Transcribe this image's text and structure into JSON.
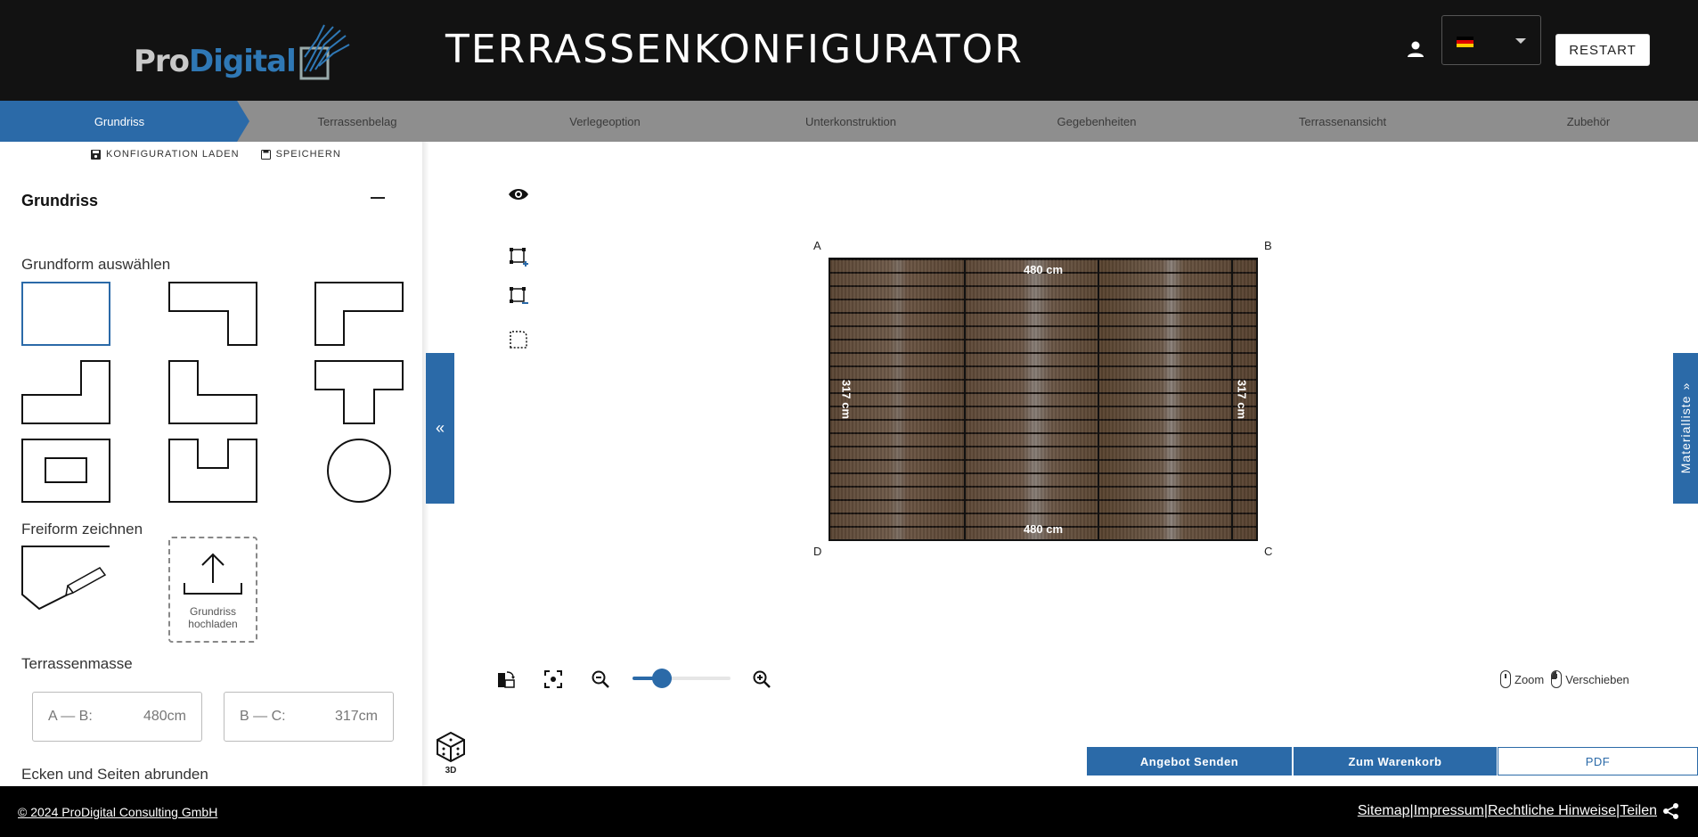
{
  "header": {
    "logo_pro": "Pro",
    "logo_digital": "Digital",
    "title": "TERRASSENKONFIGURATOR",
    "restart_label": "RESTART",
    "language_flag": "de"
  },
  "steps": [
    {
      "label": "Grundriss",
      "active": true
    },
    {
      "label": "Terrassenbelag"
    },
    {
      "label": "Verlegeoption"
    },
    {
      "label": "Unterkonstruktion"
    },
    {
      "label": "Gegebenheiten"
    },
    {
      "label": "Terrassenansicht"
    },
    {
      "label": "Zubehör"
    }
  ],
  "left_panel": {
    "load_label": "KONFIGURATION LADEN",
    "save_label": "SPEICHERN",
    "section_title": "Grundriss",
    "shape_label": "Grundform auswählen",
    "freeform_label": "Freiform zeichnen",
    "upload_label_1": "Grundriss",
    "upload_label_2": "hochladen",
    "dimensions_label": "Terrassenmasse",
    "dim_ab_label": "A — B:",
    "dim_ab_value": "480cm",
    "dim_bc_label": "B — C:",
    "dim_bc_value": "317cm",
    "round_label": "Ecken und Seiten abrunden"
  },
  "canvas": {
    "corners": [
      "A",
      "B",
      "C",
      "D"
    ],
    "top_dim": "480 cm",
    "bottom_dim": "480 cm",
    "left_dim": "317 cm",
    "right_dim": "317 cm",
    "zoom_level": 0.3,
    "hint_zoom": "Zoom",
    "hint_move": "Verschieben",
    "btn_3d": "3D"
  },
  "right_toggle_label": "Materialliste",
  "actions": {
    "offer": "Angebot Senden",
    "cart": "Zum Warenkorb",
    "pdf": "PDF"
  },
  "footer": {
    "copyright": "© 2024 ProDigital Consulting GmbH",
    "links": [
      "Sitemap",
      "Impressum",
      "Rechtliche Hinweise",
      "Teilen"
    ],
    "separator": "|"
  },
  "colors": {
    "accent": "#2b6aa8",
    "header_bg": "#121212",
    "steps_bg": "#8e8e8e"
  }
}
